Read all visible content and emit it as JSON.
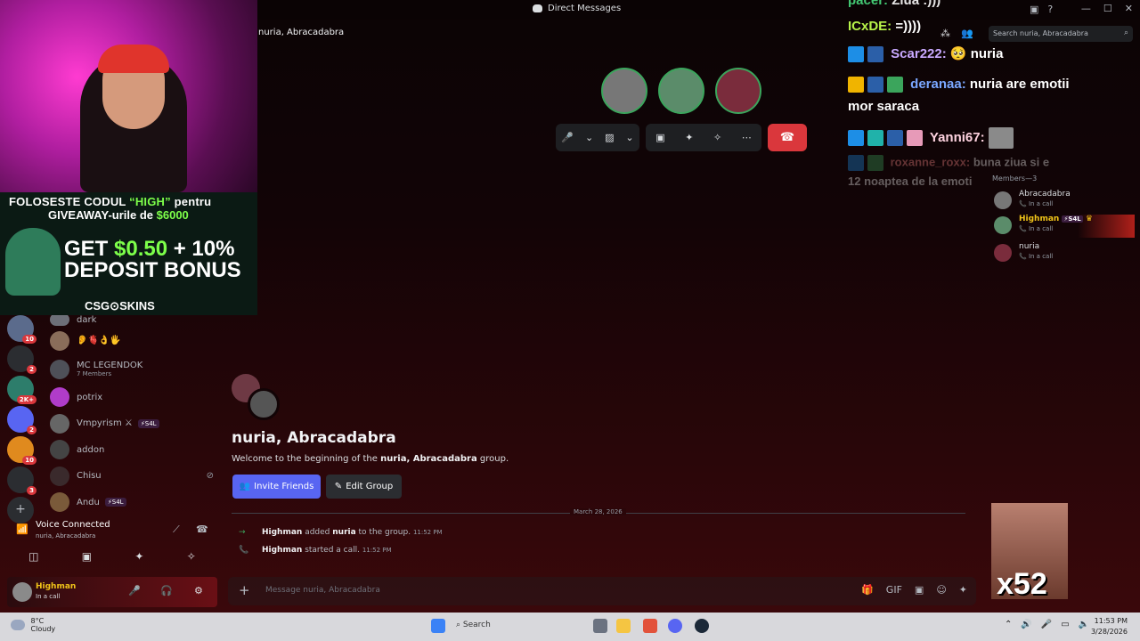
{
  "titlebar": {
    "title": "Direct Messages",
    "controls": [
      "—",
      "☐",
      "✕"
    ],
    "icons": [
      "▣",
      "?"
    ]
  },
  "webcam": {
    "promo_line1_pre": "FOLOSESTE CODUL ",
    "promo_code": "“HIGH”",
    "promo_line1_post": " pentru",
    "promo_line2_pre": "GIVEAWAY-urile de ",
    "promo_amount": "$6000",
    "big_pre": "GET ",
    "big_amount": "$0.50",
    "big_post": " + 10%",
    "big_line2": "DEPOSIT BONUS",
    "brand": "CSG⊙SKINS"
  },
  "servers": [
    {
      "color": "#5b6b8c",
      "badge": "10"
    },
    {
      "color": "#2b2d31",
      "badge": "2"
    },
    {
      "color": "#2d7d6b",
      "badge": "2K+"
    },
    {
      "color": "#5865f2",
      "badge": "2"
    },
    {
      "color": "#e08a1e",
      "badge": "10"
    },
    {
      "color": "#2b2d31",
      "badge": "3"
    }
  ],
  "dms": [
    {
      "name": "dark",
      "color": "#6d6f78"
    },
    {
      "name": "👂🫀👌🖐",
      "color": "#8a6d5a"
    },
    {
      "name": "MC LEGENDOK",
      "sub": "7 Members",
      "color": "#4e5058"
    },
    {
      "name": "potrix",
      "color": "#b03cc9"
    },
    {
      "name": "Vmpyrism ⚔",
      "tag": "⚡S4L",
      "color": "#666"
    },
    {
      "name": "addon",
      "color": "#444"
    },
    {
      "name": "Chisu",
      "color": "#3a2a2c"
    },
    {
      "name": "Andu",
      "tag": "⚡S4L",
      "color": "#7a5a3a"
    }
  ],
  "dm_block_icon": "⊘",
  "voice": {
    "status": "Voice Connected",
    "channel": "nuria, Abracadabra",
    "signal_icon": "📶",
    "actions": [
      "◫",
      "▣",
      "✦",
      "✧"
    ]
  },
  "user": {
    "name": "Highman",
    "status": "In a call",
    "controls": [
      "🎤",
      "🎧",
      "⚙"
    ]
  },
  "channel_title": "nuria, Abracadabra",
  "search_placeholder": "Search nuria, Abracadabra",
  "call": {
    "participants": [
      {
        "name": "Abracadabra",
        "color": "#777777"
      },
      {
        "name": "Highman",
        "color": "#5b8c6a"
      },
      {
        "name": "nuria",
        "color": "#7a2c3c"
      }
    ],
    "controls_left": [
      "🎤",
      "⌄",
      "▨",
      "⌄"
    ],
    "controls_right": [
      "▣",
      "✦",
      "✧",
      "⋯"
    ],
    "hangup": "☎"
  },
  "chat_overlay": [
    {
      "user": "pacer:",
      "msg": "Ziua :)))",
      "color": "#4ade80"
    },
    {
      "user": "ICxDE:",
      "msg": "=))))",
      "color": "#b7f34a"
    },
    {
      "user": "Scar222:",
      "msg": "🥺 nuria",
      "color": "#c9a9ff"
    },
    {
      "user": "deranaa:",
      "msg": "nuria are emotii",
      "color": "#7aa7ff"
    },
    {
      "user": "",
      "msg": "mor saraca",
      "color": "#ffffff"
    },
    {
      "user": "Yanni67:",
      "msg": "",
      "color": "#ffd3e0"
    },
    {
      "user": "roxanne_roxx:",
      "msg": "buna ziua si e",
      "color": "#ff8a8a"
    },
    {
      "user": "",
      "msg": "12 noaptea de la emoti",
      "color": "#ffffff"
    }
  ],
  "members": {
    "header": "Members—3",
    "list": [
      {
        "name": "Abracadabra",
        "status": "In a call",
        "color": "#777"
      },
      {
        "name": "Highman",
        "status": "In a call",
        "tag": "⚡S4L",
        "color": "#5b8c6a",
        "highlight": true
      },
      {
        "name": "nuria",
        "status": "In a call",
        "color": "#7a2c3c"
      }
    ]
  },
  "group": {
    "name": "nuria, Abracadabra",
    "welcome_pre": "Welcome to the beginning of the ",
    "welcome_bold": "nuria, Abracadabra",
    "welcome_post": " group.",
    "invite_label": "Invite Friends",
    "edit_label": "Edit Group"
  },
  "divider_date": "March 28, 2026",
  "system_messages": [
    {
      "icon": "→",
      "actor": "Highman",
      "text": " added ",
      "target": "nuria",
      "rest": " to the group.",
      "time": "11:52 PM"
    },
    {
      "icon": "📞",
      "actor": "Highman",
      "text": " started a call.",
      "target": "",
      "rest": "",
      "time": "11:52 PM"
    }
  ],
  "composer": {
    "placeholder": "Message nuria, Abracadabra",
    "tools": [
      "🎁",
      "GIF",
      "▣",
      "☺",
      "✦"
    ]
  },
  "emote": {
    "label": "x52"
  },
  "taskbar": {
    "temp": "8°C",
    "condition": "Cloudy",
    "search": "Search",
    "time": "11:53 PM",
    "date": "3/28/2026",
    "tray": [
      "⌃",
      "🔊",
      "🎤",
      "▭",
      "🔈",
      "📶"
    ]
  }
}
